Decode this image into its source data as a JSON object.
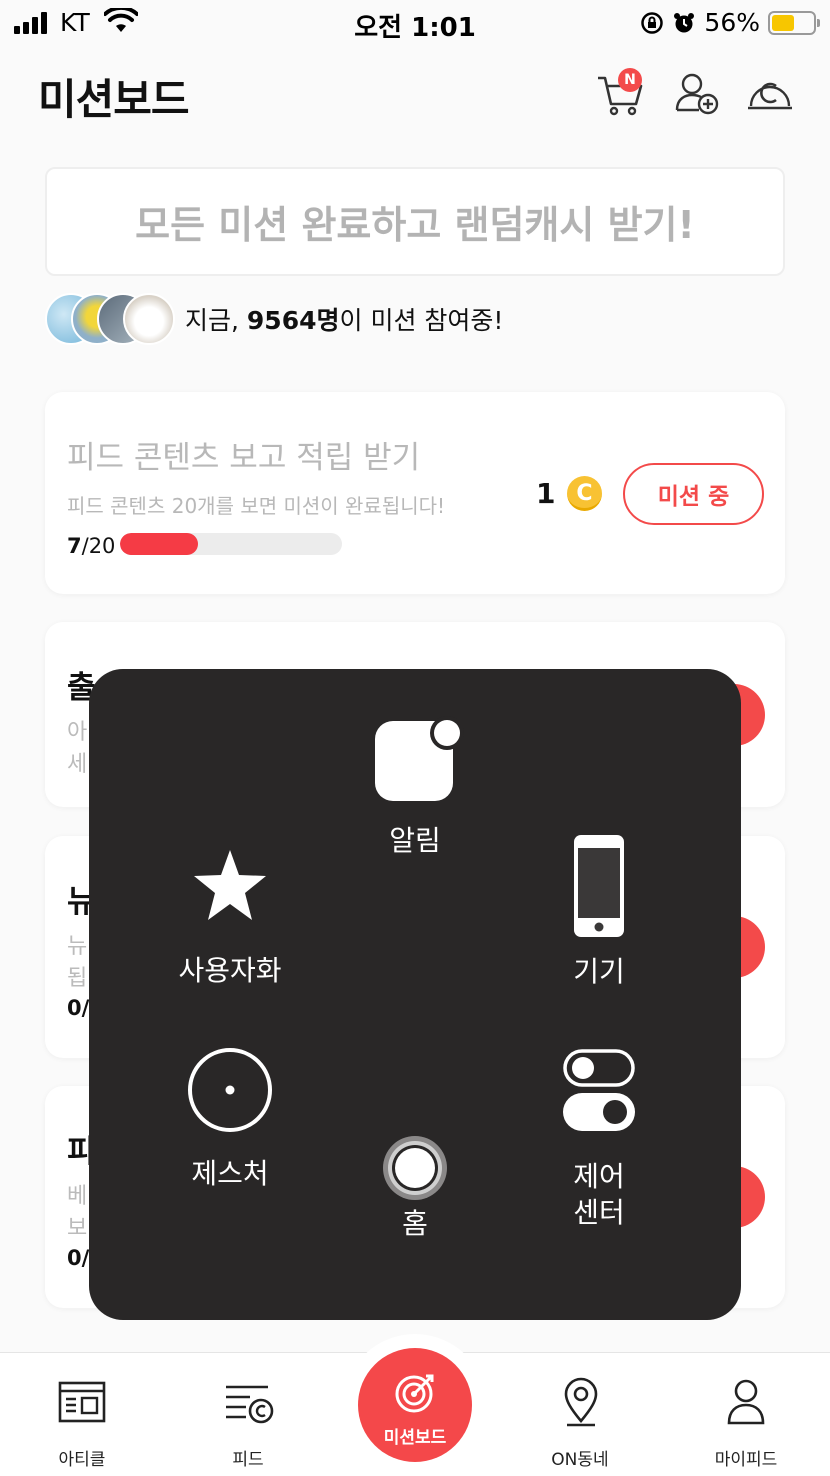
{
  "status_bar": {
    "carrier": "KT",
    "time": "오전 1:01",
    "battery": "56%"
  },
  "header": {
    "title": "미션보드",
    "cart_badge": "N"
  },
  "banner": {
    "text": "모든 미션 완료하고 랜덤캐시 받기!"
  },
  "participants": {
    "prefix": "지금, ",
    "count": "9564명",
    "suffix": "이 미션 참여중!"
  },
  "mission_card": {
    "title": "피드 콘텐츠 보고 적립 받기",
    "description": "피드 콘텐츠 20개를 보면 미션이 완료됩니다!",
    "progress_current": "7",
    "progress_total": "/20",
    "progress_fraction": 0.35,
    "reward": "1",
    "coin_symbol": "C",
    "button_label": "미션 중"
  },
  "peek": {
    "card2_title": "출",
    "card2_line1": "아",
    "card2_line2": "세",
    "card3_title": "뉴",
    "card3_line1": "뉴",
    "card3_line2": "됩",
    "card3_progress": "0/",
    "card4_title": "피",
    "card4_line1": "베",
    "card4_line2": "보",
    "card4_progress": "0/"
  },
  "assistive_touch": {
    "notifications": "알림",
    "custom": "사용자화",
    "device": "기기",
    "gestures": "제스처",
    "home": "홈",
    "control_center_line1": "제어",
    "control_center_line2": "센터"
  },
  "tabbar": {
    "article": "아티클",
    "feed": "피드",
    "mission_board": "미션보드",
    "on_neighborhood": "ON동네",
    "my_feed": "마이피드"
  },
  "colors": {
    "accent": "#f34a4a",
    "coin": "#f8c233",
    "overlay": "#292727"
  }
}
